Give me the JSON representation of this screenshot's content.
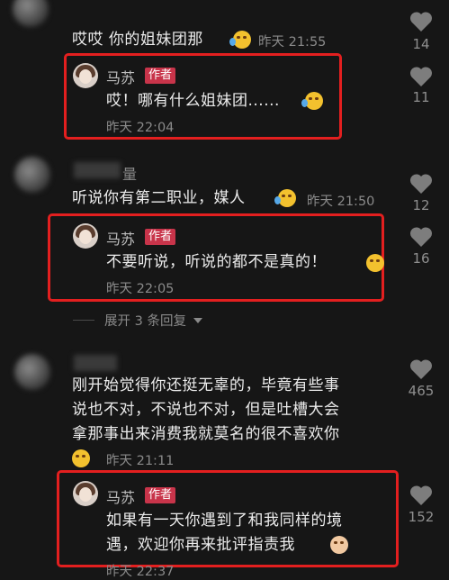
{
  "comments": [
    {
      "text": "哎哎 你的姐妹团那",
      "time": "昨天 21:55",
      "likes": "14",
      "reply": {
        "user": "马苏",
        "tag": "作者",
        "text": "哎！哪有什么姐妹团......",
        "time": "昨天 22:04",
        "likes": "11"
      }
    },
    {
      "username": "量",
      "text": "听说你有第二职业，媒人",
      "time": "昨天 21:50",
      "likes": "12",
      "reply": {
        "user": "马苏",
        "tag": "作者",
        "text": "不要听说，听说的都不是真的！",
        "time": "昨天 22:05",
        "likes": "16"
      },
      "expand": "展开 3 条回复"
    },
    {
      "text_lines": [
        "刚开始觉得你还挺无辜的，毕竟有些事",
        "说也不对，不说也不对，但是吐槽大会",
        "拿那事出来消费我就莫名的很不喜欢你"
      ],
      "time": "昨天 21:11",
      "likes": "465",
      "reply": {
        "user": "马苏",
        "tag": "作者",
        "text_lines": [
          "如果有一天你遇到了和我同样的境",
          "遇，欢迎你再来批评指责我"
        ],
        "time": "昨天 22:37",
        "likes": "152"
      }
    }
  ],
  "colors": {
    "background": "#161616",
    "highlight": "#e31f1f",
    "author_tag": "#c8344a"
  },
  "icons": {
    "like": "heart-icon",
    "expand": "chevron-down-icon"
  }
}
